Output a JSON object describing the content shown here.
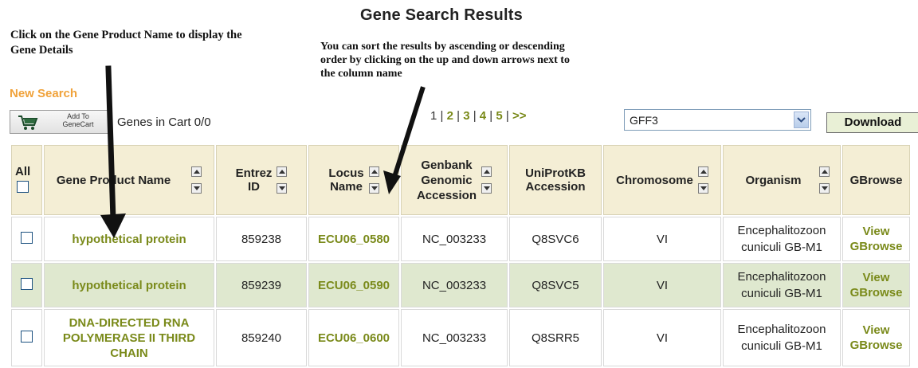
{
  "page": {
    "title": "Gene Search Results"
  },
  "annotations": {
    "left": "Click on the Gene Product Name to display the Gene Details",
    "right": "You can sort the results by ascending or descending order by clicking on the up and down arrows next to the column name"
  },
  "toolbar": {
    "new_search": "New Search",
    "add_to_cart_line1": "Add To",
    "add_to_cart_line2": "GeneCart",
    "genes_in_cart": "Genes in Cart 0/0",
    "format_selected": "GFF3",
    "download_label": "Download"
  },
  "pagination": {
    "current": "1",
    "pages": [
      "2",
      "3",
      "4",
      "5"
    ],
    "next": ">>",
    "sep": "|"
  },
  "table": {
    "headers": {
      "all": "All",
      "gene_product": "Gene Product Name",
      "entrez_line1": "Entrez",
      "entrez_line2": "ID",
      "locus_line1": "Locus",
      "locus_line2": "Name",
      "genbank_line1": "Genbank",
      "genbank_line2": "Genomic",
      "genbank_line3": "Accession",
      "uniprot_line1": "UniProtKB",
      "uniprot_line2": "Accession",
      "chromosome": "Chromosome",
      "organism": "Organism",
      "gbrowse": "GBrowse"
    },
    "rows": [
      {
        "gene_product": "hypothetical protein",
        "entrez": "859238",
        "locus": "ECU06_0580",
        "genbank": "NC_003233",
        "uniprot": "Q8SVC6",
        "chromosome": "VI",
        "organism_line1": "Encephalitozoon",
        "organism_line2": "cuniculi GB-M1",
        "gbrowse_line1": "View",
        "gbrowse_line2": "GBrowse"
      },
      {
        "gene_product": "hypothetical protein",
        "entrez": "859239",
        "locus": "ECU06_0590",
        "genbank": "NC_003233",
        "uniprot": "Q8SVC5",
        "chromosome": "VI",
        "organism_line1": "Encephalitozoon",
        "organism_line2": "cuniculi GB-M1",
        "gbrowse_line1": "View",
        "gbrowse_line2": "GBrowse"
      },
      {
        "gene_product_line1": "DNA-DIRECTED RNA",
        "gene_product_line2": "POLYMERASE II THIRD",
        "gene_product_line3": "CHAIN",
        "entrez": "859240",
        "locus": "ECU06_0600",
        "genbank": "NC_003233",
        "uniprot": "Q8SRR5",
        "chromosome": "VI",
        "organism_line1": "Encephalitozoon",
        "organism_line2": "cuniculi GB-M1",
        "gbrowse_line1": "View",
        "gbrowse_line2": "GBrowse"
      }
    ]
  },
  "colors": {
    "link": "#7a8a1a",
    "new_search": "#f0a23a",
    "header_bg": "#f4eed5",
    "alt_row_bg": "#dfe8cf"
  }
}
